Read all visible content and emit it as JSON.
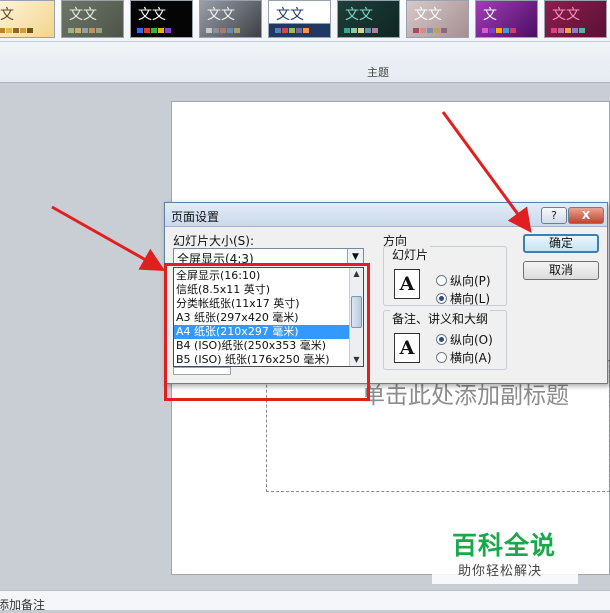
{
  "ribbon": {
    "themes": [
      {
        "label": "文",
        "bg": "linear-gradient(135deg,#fff6e2,#f2d58a)",
        "fg": "#5a4a20",
        "swatches": [
          "#b9852c",
          "#e2b84f",
          "#8a6a2a",
          "#d59b3a",
          "#6e5518"
        ]
      },
      {
        "label": "文文",
        "bg": "linear-gradient(135deg,#6d7668,#4d554a)",
        "fg": "#e8efe2",
        "swatches": [
          "#a3b18a",
          "#c8b06a",
          "#8fa2a8",
          "#c18f66",
          "#9aa07a"
        ]
      },
      {
        "label": "文文",
        "bg": "#050505",
        "fg": "#ffffff",
        "swatches": [
          "#2f6fd6",
          "#d63d2f",
          "#3ea84a",
          "#e0b020",
          "#8a3fc0"
        ]
      },
      {
        "label": "文文",
        "bg": "linear-gradient(135deg,#9aa0a8,#3c3f46)",
        "fg": "#f2f2f2",
        "swatches": [
          "#c9c9c9",
          "#8a8fa0",
          "#b07a6a",
          "#6a8ab0",
          "#a0a06a"
        ]
      },
      {
        "label": "文文",
        "bg": "linear-gradient(#ffffff 62%,#1f3864 62%)",
        "fg": "#1f3864",
        "swatches": [
          "#4f81bd",
          "#c0504d",
          "#9bbb59",
          "#8064a2",
          "#f79646"
        ]
      },
      {
        "label": "文文",
        "bg": "linear-gradient(135deg,#1d3e3a,#0e2623)",
        "fg": "#7ed6c4",
        "swatches": [
          "#3aa58f",
          "#87c9a8",
          "#d9d39a",
          "#5f8fa8",
          "#b07f9a"
        ]
      },
      {
        "label": "文文",
        "bg": "linear-gradient(135deg,#d8c9c9,#a58f91)",
        "fg": "#ffffff",
        "swatches": [
          "#a04d63",
          "#d78a8a",
          "#7a8fb0",
          "#c0a05a",
          "#8a6a7a"
        ]
      },
      {
        "label": "文",
        "bg": "linear-gradient(135deg,#a23db8,#4a0e64)",
        "fg": "#ffffff",
        "swatches": [
          "#e05ac7",
          "#7a3fd0",
          "#ffb000",
          "#3fa0d0",
          "#d03f6a"
        ]
      },
      {
        "label": "文文",
        "bg": "linear-gradient(135deg,#8c1f4e,#5a1034)",
        "fg": "#ff8fc0",
        "swatches": [
          "#e0407a",
          "#c06a9a",
          "#f0a050",
          "#8080d0",
          "#60b0a0"
        ]
      }
    ],
    "group_label": "主题"
  },
  "dialog": {
    "title": "页面设置",
    "help_label": "?",
    "close_label": "X",
    "size_label": "幻灯片大小(S):",
    "size_value": "全屏显示(4:3)",
    "size_options": [
      {
        "label": "全屏显示(16:10)",
        "selected": false
      },
      {
        "label": "信纸(8.5x11 英寸)",
        "selected": false
      },
      {
        "label": "分类帐纸张(11x17 英寸)",
        "selected": false
      },
      {
        "label": "A3 纸张(297x420 毫米)",
        "selected": false
      },
      {
        "label": "A4 纸张(210x297 毫米)",
        "selected": true
      },
      {
        "label": "B4 (ISO)纸张(250x353 毫米)",
        "selected": false
      },
      {
        "label": "B5 (ISO) 纸张(176x250 毫米)",
        "selected": false
      }
    ],
    "orientation_label": "方向",
    "slides_group": {
      "title": "幻灯片",
      "portrait": "纵向(P)",
      "landscape": "横向(L)",
      "selected": "landscape"
    },
    "notes_group": {
      "title": "备注、讲义和大纲",
      "portrait": "纵向(O)",
      "landscape": "横向(A)",
      "selected": "portrait"
    },
    "ok_label": "确定",
    "cancel_label": "取消"
  },
  "slide": {
    "subtitle_placeholder": "单击此处添加副标题",
    "right_edge_text": "|"
  },
  "status": {
    "notes": "添加备注"
  },
  "watermark": {
    "title": "百科全说",
    "subtitle": "助你轻松解决"
  },
  "annotation_color": "#e02020"
}
